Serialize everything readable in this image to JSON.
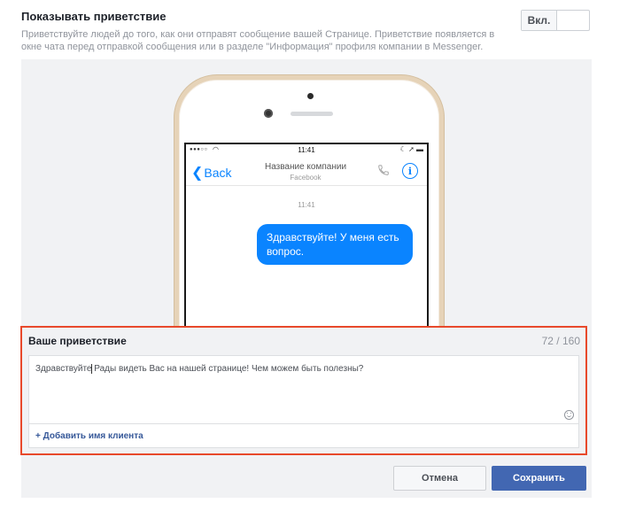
{
  "header": {
    "title": "Показывать приветствие",
    "description": "Приветствуйте людей до того, как они отправят сообщение вашей Странице. Приветствие появляется в окне чата перед отправкой сообщения или в разделе \"Информация\" профиля компании в Messenger.",
    "toggle_label": "Вкл."
  },
  "phone": {
    "status_signal": "●●●○○",
    "status_time": "11:41",
    "back_label": "Back",
    "contact_name": "Название компании",
    "contact_subtitle": "Facebook",
    "message_time": "11:41",
    "message_text": "Здравствуйте! У меня есть вопрос."
  },
  "greeting": {
    "label": "Ваше приветствие",
    "counter": "72 / 160",
    "text_before_caret": "Здравствуйте",
    "text_after_caret": " Рады видеть Вас на нашей странице! Чем можем быть полезны?",
    "add_client_name": "+ Добавить имя клиента"
  },
  "buttons": {
    "cancel": "Отмена",
    "save": "Сохранить"
  },
  "colors": {
    "accent": "#4267b2",
    "link": "#365899",
    "bubble": "#0a84ff",
    "highlight": "#e8492b"
  }
}
